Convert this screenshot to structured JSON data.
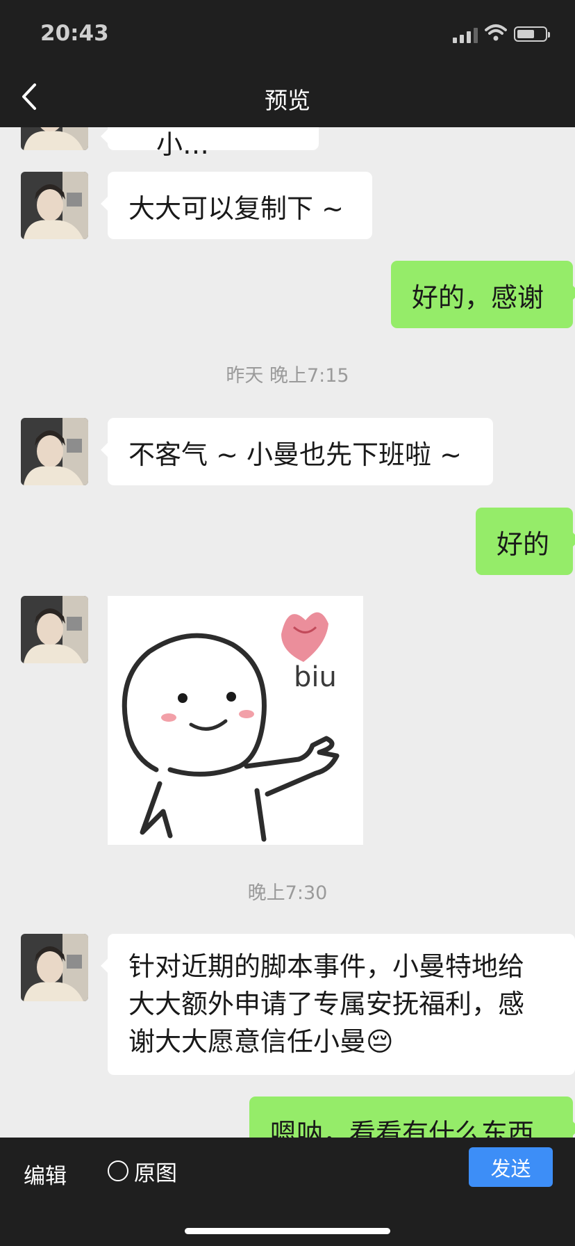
{
  "status_bar": {
    "time": "20:43"
  },
  "nav": {
    "title": "预览"
  },
  "messages": {
    "partial_top": "…和这们的小…",
    "m1": "大大可以复制下 ~",
    "m2": "好的，感谢",
    "ts1": "昨天 晚上7:15",
    "m3": "不客气 ~ 小曼也先下班啦 ~",
    "m4": "好的",
    "sticker_text": "biu",
    "ts2": "晚上7:30",
    "m5_line1": "针对近期的脚本事件，小曼特地给",
    "m5_line2": "大大额外申请了专属安抚福利，感",
    "m5_line3": "谢大大愿意信任小曼😔",
    "m6": "嗯呐，看看有什么东西"
  },
  "bottom_bar": {
    "edit_label": "编辑",
    "original_label": "原图",
    "send_label": "发送"
  },
  "colors": {
    "chat_bg": "#ededed",
    "bar_bg": "#1f1f1f",
    "incoming": "#ffffff",
    "outgoing": "#95ec69",
    "send_button": "#3d8ef7"
  }
}
